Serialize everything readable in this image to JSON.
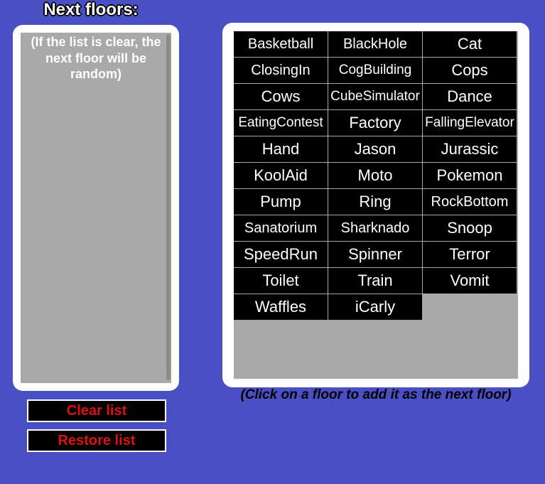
{
  "title": "Next floors:",
  "left": {
    "placeholder": "(If the list is clear, the next floor will be random)"
  },
  "buttons": {
    "clear": "Clear list",
    "restore": "Restore list"
  },
  "hint": "(Click on a floor to add it as the next floor)",
  "floors": [
    "Basketball",
    "BlackHole",
    "Cat",
    "ClosingIn",
    "CogBuilding",
    "Cops",
    "Cows",
    "CubeSimulator",
    "Dance",
    "EatingContest",
    "Factory",
    "FallingElevator",
    "Hand",
    "Jason",
    "Jurassic",
    "KoolAid",
    "Moto",
    "Pokemon",
    "Pump",
    "Ring",
    "RockBottom",
    "Sanatorium",
    "Sharknado",
    "Snoop",
    "SpeedRun",
    "Spinner",
    "Terror",
    "Toilet",
    "Train",
    "Vomit",
    "Waffles",
    "iCarly"
  ]
}
